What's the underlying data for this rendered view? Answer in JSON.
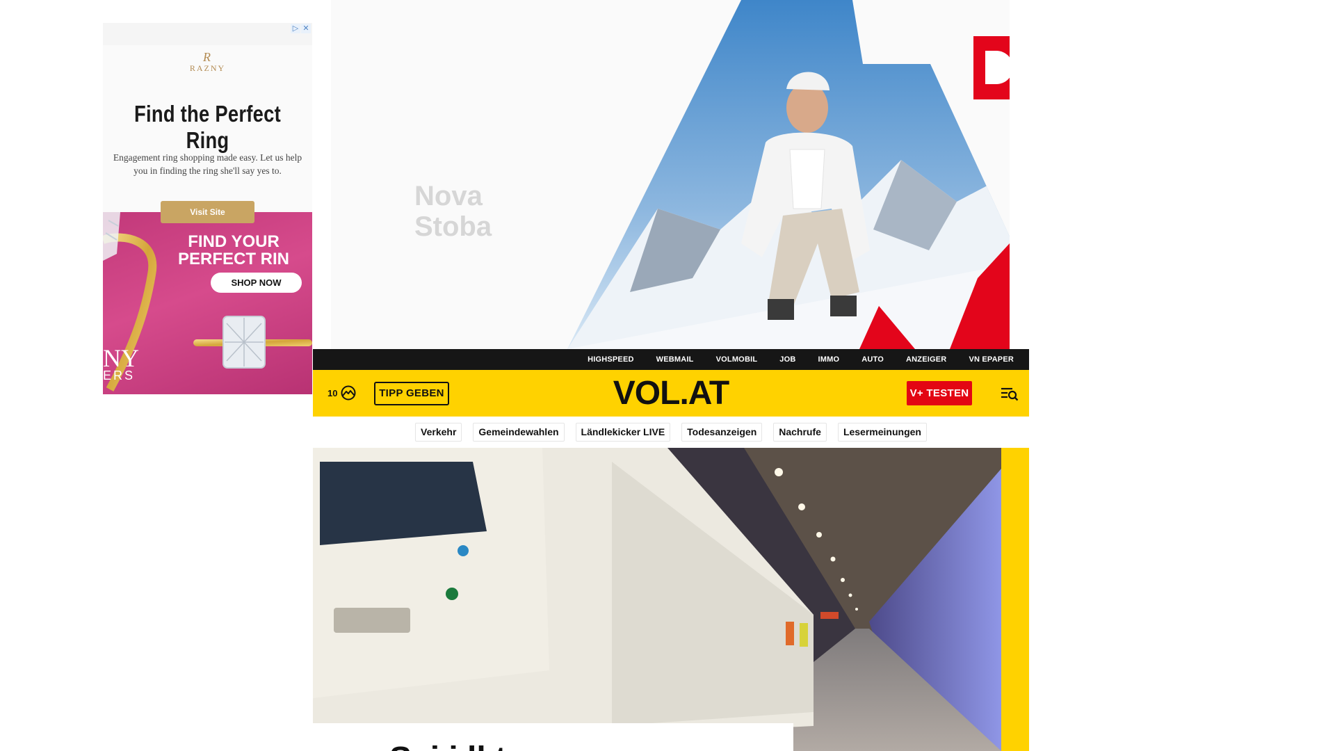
{
  "side_ad": {
    "adchoices": [
      "▷",
      "✕"
    ],
    "brand_monogram": "R",
    "brand": "RAZNY",
    "headline": "Find the Perfect Ring",
    "subtext": "Engagement ring shopping made easy. Let us help you in finding the ring she'll say yes to.",
    "cta": "Visit Site",
    "banner_title_line1": "FIND YOUR",
    "banner_title_line2": "PERFECT RIN",
    "banner_cta": "SHOP NOW",
    "banner_brand_fragment1": "NY",
    "banner_brand_fragment2": "ERS"
  },
  "hero_ad": {
    "watermark_line1": "Nova",
    "watermark_line2": "Stoba"
  },
  "topbar": {
    "links": [
      "HIGHSPEED",
      "WEBMAIL",
      "VOLMOBIL",
      "JOB",
      "IMMO",
      "AUTO",
      "ANZEIGER",
      "VN EPAPER"
    ]
  },
  "header": {
    "temperature": "10",
    "weather_icon": "partly-cloudy-icon",
    "tipp_button": "TIPP GEBEN",
    "logo": "VOL.AT",
    "subscribe_button": "V+ TESTEN",
    "menu_icon": "menu-search-icon"
  },
  "chips": [
    "Verkehr",
    "Gemeindewahlen",
    "Ländlekicker LIVE",
    "Todesanzeigen",
    "Nachrufe",
    "Lesermeinungen"
  ],
  "story": {
    "headline_fragment": "Sai    i    ll      t"
  },
  "colors": {
    "brand_yellow": "#ffd200",
    "brand_red": "#e30613",
    "topbar_black": "#161616"
  }
}
